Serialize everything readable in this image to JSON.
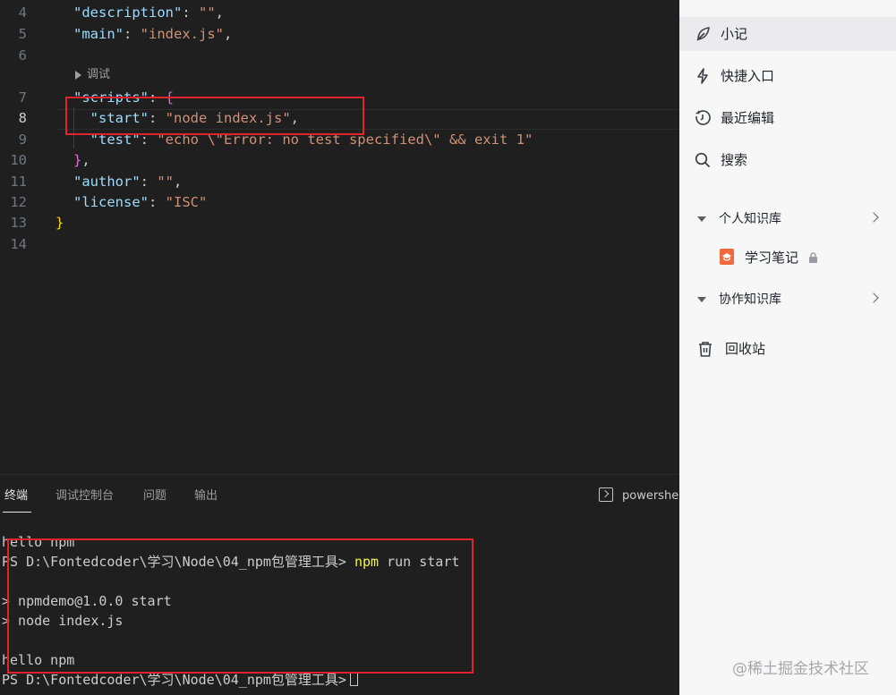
{
  "editor": {
    "lines": [
      {
        "n": "4",
        "html": [
          [
            "k",
            "\"description\""
          ],
          [
            "p",
            ": "
          ],
          [
            "s",
            "\"\""
          ],
          [
            "p",
            ","
          ]
        ]
      },
      {
        "n": "5",
        "html": [
          [
            "k",
            "\"main\""
          ],
          [
            "p",
            ": "
          ],
          [
            "s",
            "\"index.js\""
          ],
          [
            "p",
            ","
          ]
        ]
      },
      {
        "n": "6",
        "html": []
      },
      {
        "n": "7",
        "html": [
          [
            "k",
            "\"scripts\""
          ],
          [
            "p",
            ": "
          ],
          [
            "b2",
            "{"
          ]
        ]
      },
      {
        "n": "8",
        "html": [
          [
            "p",
            "  "
          ],
          [
            "k",
            "\"start\""
          ],
          [
            "p",
            ": "
          ],
          [
            "s",
            "\"node index.js\""
          ],
          [
            "p",
            ","
          ]
        ]
      },
      {
        "n": "9",
        "html": [
          [
            "p",
            "  "
          ],
          [
            "k",
            "\"test\""
          ],
          [
            "p",
            ": "
          ],
          [
            "s",
            "\"echo \\\"Error: no test specified\\\" && exit 1\""
          ]
        ]
      },
      {
        "n": "10",
        "html": [
          [
            "b2",
            "}"
          ],
          [
            "p",
            ","
          ]
        ]
      },
      {
        "n": "11",
        "html": [
          [
            "k",
            "\"author\""
          ],
          [
            "p",
            ": "
          ],
          [
            "s",
            "\"\""
          ],
          [
            "p",
            ","
          ]
        ]
      },
      {
        "n": "12",
        "html": [
          [
            "k",
            "\"license\""
          ],
          [
            "p",
            ": "
          ],
          [
            "s",
            "\"ISC\""
          ]
        ]
      },
      {
        "n": "13",
        "html": [
          [
            "b1",
            "}"
          ]
        ]
      },
      {
        "n": "14",
        "html": []
      }
    ],
    "codelens": "调试"
  },
  "panel": {
    "tabs": [
      "终端",
      "调试控制台",
      "问题",
      "输出"
    ],
    "shell_label": "powershell"
  },
  "terminal": {
    "lines": [
      "hello npm",
      "PS D:\\Fontedcoder\\学习\\Node\\04_npm包管理工具> ",
      "",
      "> npmdemo@1.0.0 start",
      "> node index.js",
      "",
      "hello npm",
      "PS D:\\Fontedcoder\\学习\\Node\\04_npm包管理工具>"
    ],
    "command_bold": "npm",
    "command_rest": " run start"
  },
  "sidebar": {
    "items": [
      {
        "label": "小记",
        "icon": "feather-icon"
      },
      {
        "label": "快捷入口",
        "icon": "lightning-icon"
      },
      {
        "label": "最近编辑",
        "icon": "clock-icon"
      },
      {
        "label": "搜索",
        "icon": "search-icon"
      }
    ],
    "personal_group": "个人知识库",
    "notebook": "学习笔记",
    "collab_group": "协作知识库",
    "trash": "回收站"
  },
  "watermark": "@稀土掘金技术社区",
  "colors": {
    "accent_red": "#e0242c",
    "notebook_icon": "#f06a3d"
  }
}
